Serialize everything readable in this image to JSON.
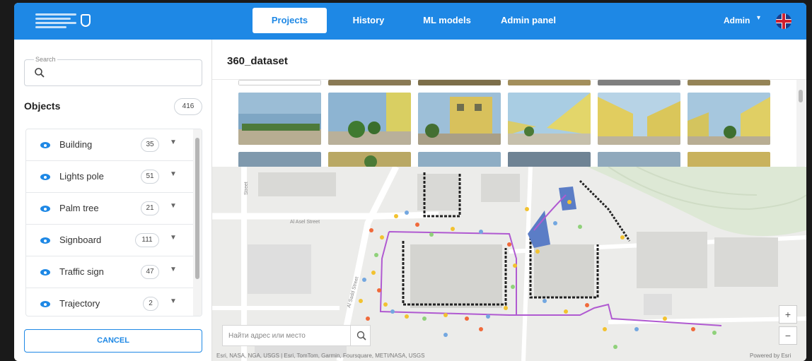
{
  "header": {
    "tabs": [
      {
        "label": "Projects",
        "active": true
      },
      {
        "label": "History",
        "active": false
      },
      {
        "label": "ML models",
        "active": false
      },
      {
        "label": "Admin panel",
        "active": false
      }
    ],
    "user": "Admin",
    "language_flag": "uk-flag-icon",
    "accent": "#1e88e5"
  },
  "sidebar": {
    "search": {
      "label": "Search",
      "value": ""
    },
    "objects_title": "Objects",
    "objects_count": "416",
    "items": [
      {
        "label": "Building",
        "count": "35"
      },
      {
        "label": "Lights pole",
        "count": "51"
      },
      {
        "label": "Palm tree",
        "count": "21"
      },
      {
        "label": "Signboard",
        "count": "111"
      },
      {
        "label": "Traffic sign",
        "count": "47"
      },
      {
        "label": "Trajectory",
        "count": "2"
      }
    ],
    "cancel_label": "CANCEL"
  },
  "main": {
    "dataset_title": "360_dataset",
    "map": {
      "search_placeholder": "Найти адрес или место",
      "street_1": "Al Asel Street",
      "street_2": "Street",
      "street_3": "Al Sadd Street",
      "attribution": "Esri, NASA, NGA, USGS | Esri, TomTom, Garmin, Foursquare, METI/NASA, USGS",
      "powered_by": "Powered by Esri",
      "zoom_in": "+",
      "zoom_out": "−"
    }
  }
}
